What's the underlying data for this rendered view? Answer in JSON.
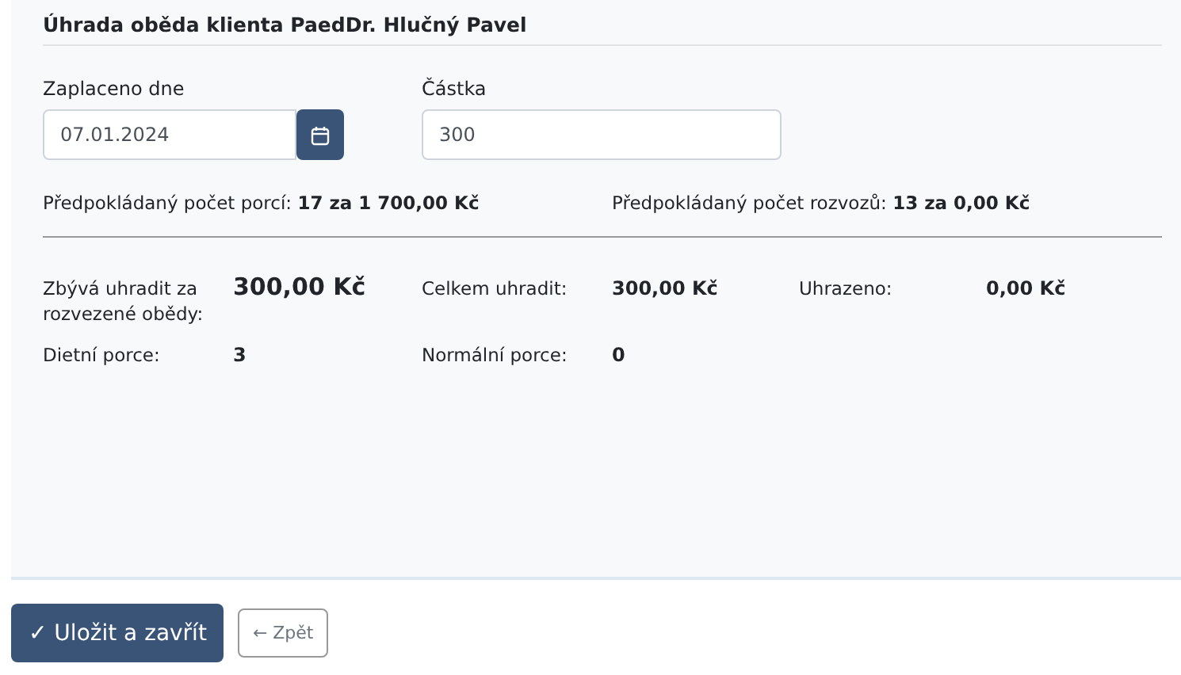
{
  "title": "Úhrada oběda klienta PaedDr. Hlučný Pavel",
  "date_field": {
    "label": "Zaplaceno dne",
    "value": "07.01.2024"
  },
  "amount_field": {
    "label": "Částka",
    "value": "300"
  },
  "estimates": [
    {
      "text": "Předpokládaný počet porcí: **17 za 1 700,00 Kč**"
    },
    {
      "text": "Předpokládaný počet rozvozů: **13 za 0,00 Kč**"
    }
  ],
  "summary_rows": [
    [
      {
        "label": "Zbývá uhradit za rozvezené obědy:",
        "value": "300,00 Kč",
        "large": true
      },
      {
        "label": "Celkem uhradit:",
        "value": "300,00 Kč",
        "large": false
      },
      {
        "label": "Uhrazeno:",
        "value": "0,00 Kč",
        "large": false
      }
    ],
    [
      {
        "label": "Dietní porce:",
        "value": "3",
        "large": false
      },
      {
        "label": "Normální porce:",
        "value": "0",
        "large": false
      }
    ]
  ],
  "buttons": {
    "save": "✓ Uložit a zavřít",
    "back": "← Zpět"
  }
}
